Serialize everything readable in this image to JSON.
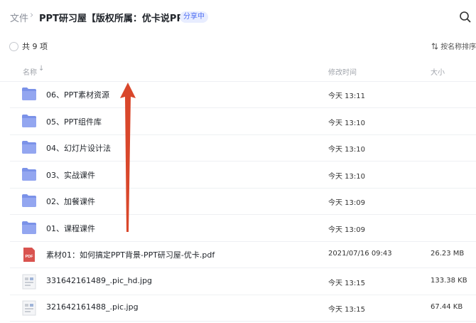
{
  "breadcrumb": {
    "root": "文件",
    "separator": "›",
    "title": "PPT研习屋【版权所属：优卡说PPT】",
    "badge": "分享中"
  },
  "toolbar": {
    "count": "共 9 项",
    "sort_label": "按名称排序",
    "sort_icon": "sort-arrows-icon",
    "search_icon": "search-icon"
  },
  "columns": {
    "name": "名称",
    "name_sort_arrow": "↓",
    "time": "修改时间",
    "size": "大小"
  },
  "files": [
    {
      "icon": "folder-icon",
      "name": "06、PPT素材资源",
      "time": "今天 13:11",
      "size": ""
    },
    {
      "icon": "folder-icon",
      "name": "05、PPT组件库",
      "time": "今天 13:10",
      "size": ""
    },
    {
      "icon": "folder-icon",
      "name": "04、幻灯片设计法",
      "time": "今天 13:10",
      "size": ""
    },
    {
      "icon": "folder-icon",
      "name": "03、实战课件",
      "time": "今天 13:10",
      "size": ""
    },
    {
      "icon": "folder-icon",
      "name": "02、加餐课件",
      "time": "今天 13:09",
      "size": ""
    },
    {
      "icon": "folder-icon",
      "name": "01、课程课件",
      "time": "今天 13:09",
      "size": ""
    },
    {
      "icon": "pdf-file-icon",
      "icon_text": "PDF",
      "name": "素材01：如何搞定PPT背景-PPT研习屋-优卡.pdf",
      "time": "2021/07/16 09:43",
      "size": "26.23 MB"
    },
    {
      "icon": "image-thumbnail-icon",
      "name": "331642161489_.pic_hd.jpg",
      "time": "今天 13:15",
      "size": "133.38 KB"
    },
    {
      "icon": "image-thumbnail-icon",
      "name": "321642161488_.pic.jpg",
      "time": "今天 13:15",
      "size": "67.44 KB"
    }
  ],
  "colors": {
    "accent": "#4e6ef2",
    "folder": "#7b92e8",
    "pdf": "#d9534f",
    "annotation_arrow": "#d9472b"
  },
  "annotation": {
    "icon": "red-up-arrow-annotation"
  }
}
